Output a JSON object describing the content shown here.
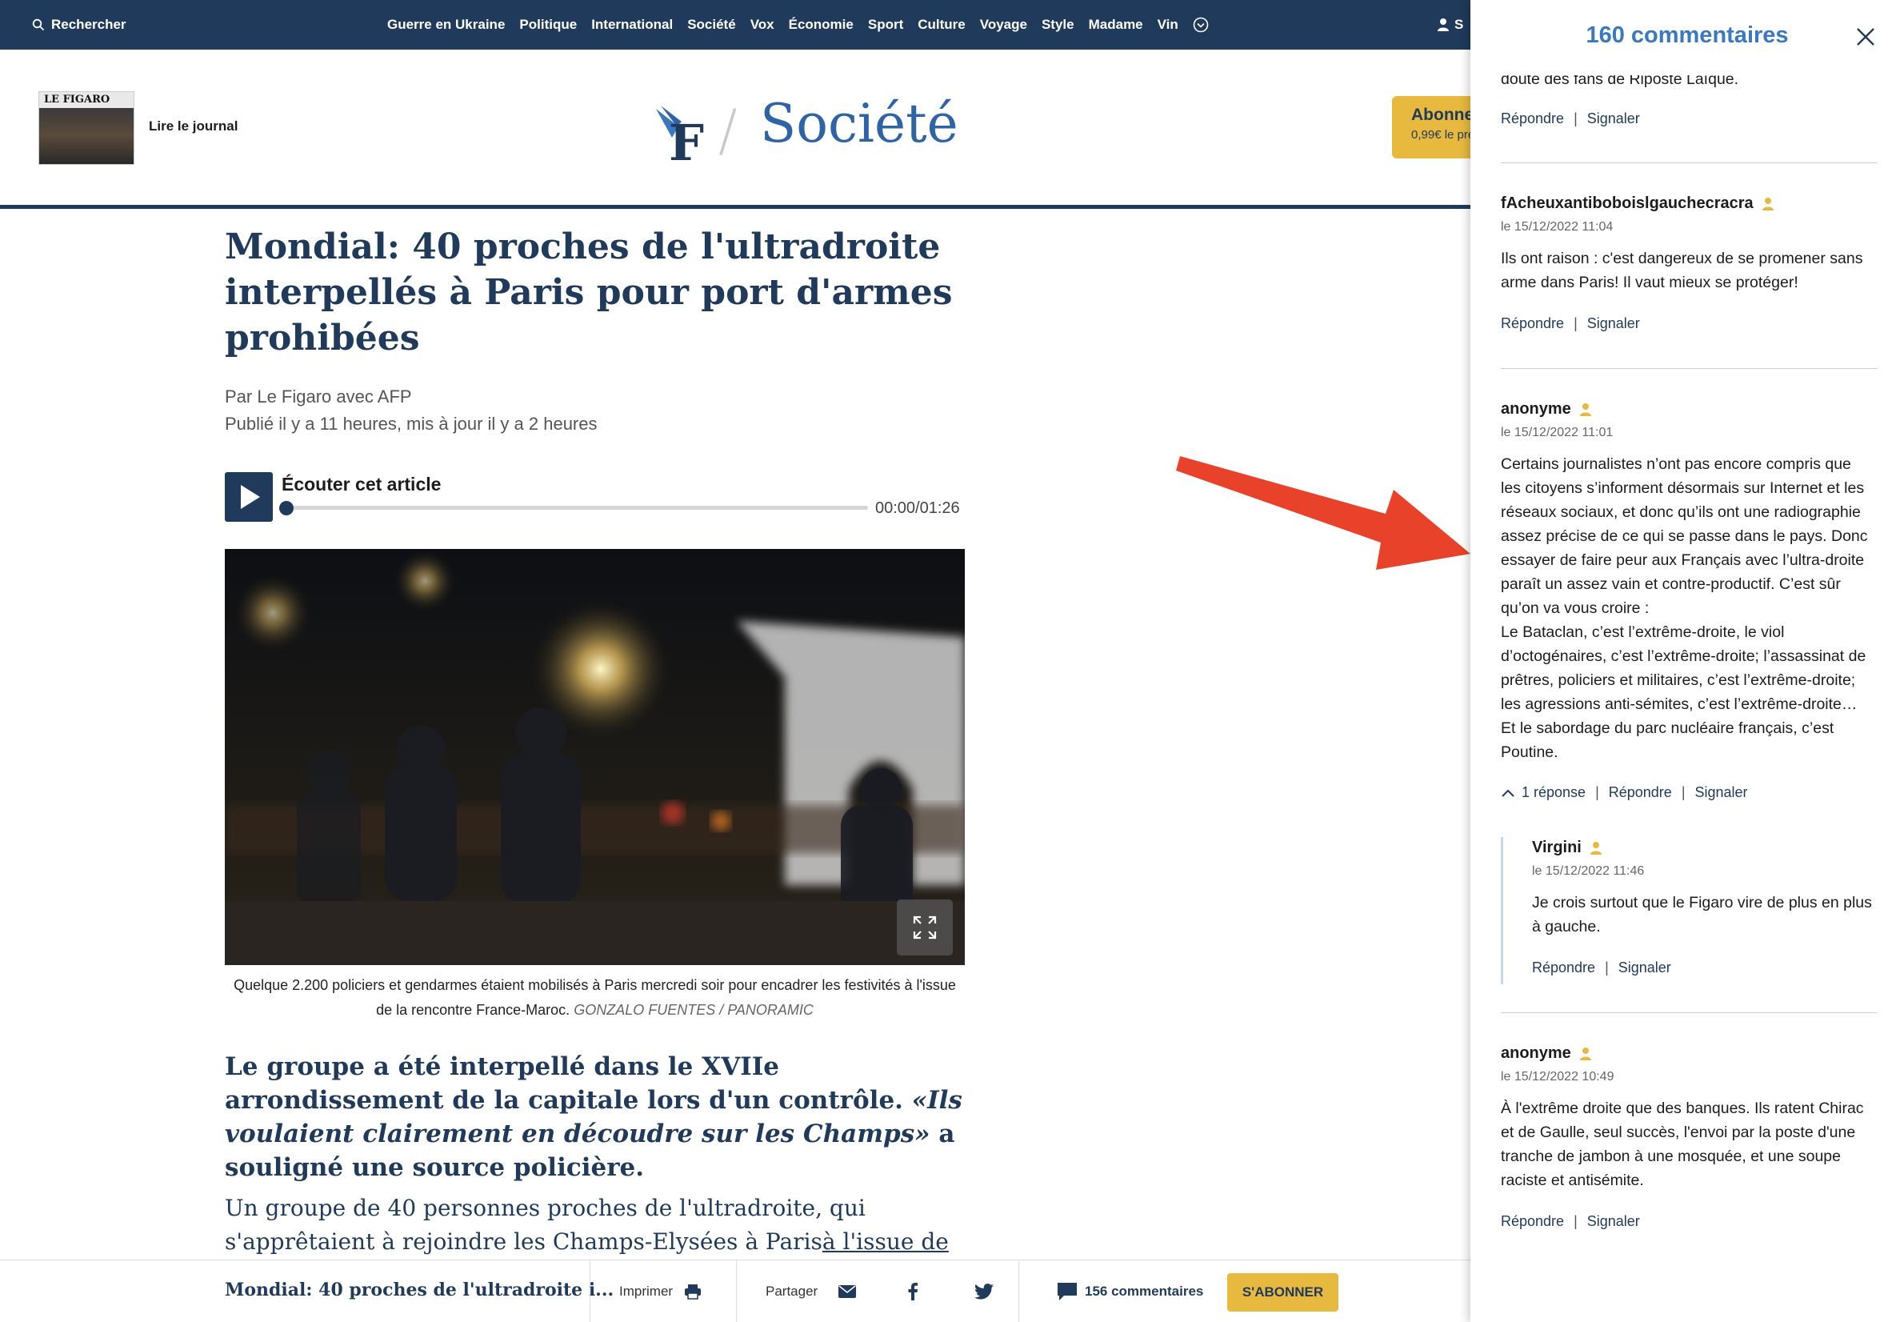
{
  "nav": {
    "search_label": "Rechercher",
    "items": [
      "Guerre en Ukraine",
      "Politique",
      "International",
      "Société",
      "Vox",
      "Économie",
      "Sport",
      "Culture",
      "Voyage",
      "Style",
      "Madame",
      "Vin"
    ],
    "user_label": "S"
  },
  "masthead": {
    "journal_label": "Lire le journal",
    "journal_mast": "LE FIGARO",
    "section": "Société",
    "subscribe_l1": "Abonne",
    "subscribe_l2": "0,99€ le pre"
  },
  "article": {
    "title": "Mondial: 40 proches de l'ultradroite interpellés à Paris pour port d'armes prohibées",
    "author": "Par Le Figaro avec AFP",
    "published": "Publié il y a 11 heures, mis à jour il y a 2 heures",
    "audio_label": "Écouter cet article",
    "audio_time": "00:00/01:26",
    "audio_progress": 0,
    "caption_main": "Quelque 2.200 policiers et gendarmes étaient mobilisés à Paris mercredi soir pour encadrer les festivités à l'issue de la rencontre France-Maroc.",
    "caption_credit": "GONZALO FUENTES / PANORAMIC",
    "chapo_a": "Le groupe a été interpellé dans le XVIIe arrondissement de la capitale lors d'un contrôle. ",
    "chapo_quote": "«Ils voulaient clairement en découdre sur les Champs»",
    "chapo_b": " a souligné une source policière.",
    "body_a": "Un groupe de 40 personnes proches de l'ultradroite, qui s'apprêtaient à rejoindre les Champs-Elysées à Paris",
    "body_link": "à l'issue de la demi-finale du"
  },
  "bottombar": {
    "title": "Mondial: 40 proches de l'ultradroite i...",
    "print": "Imprimer",
    "share": "Partager",
    "comments": "156 commentaires",
    "subscribe": "S'ABONNER"
  },
  "comments_panel": {
    "title": "160 commentaires",
    "reply": "Répondre",
    "report": "Signaler",
    "partial_text": "doute des fans de Riposte Laïque.",
    "items": [
      {
        "author": "fAcheuxantiboboislgauchecracra",
        "date": "le 15/12/2022 11:04",
        "text": "Ils ont raison : c'est dangereux de se promener sans arme dans Paris! Il vaut mieux se protéger!"
      },
      {
        "author": "anonyme",
        "date": "le 15/12/2022 11:01",
        "text_lines": [
          "Certains journalistes n’ont pas encore compris que",
          "les citoyens s’informent désormais sur Internet et les",
          "réseaux sociaux, et donc qu’ils ont une radiographie",
          "assez précise de ce qui se passe dans le pays. Donc",
          "essayer de faire peur aux Français avec l’ultra-droite",
          "paraît un assez vain et contre-productif. C’est sûr",
          "qu’on va vous croire :",
          "Le Bataclan, c’est l’extrême-droite, le viol",
          "d’octogénaires, c’est l’extrême-droite; l’assassinat de",
          "prêtres, policiers et militaires, c’est l’extrême-droite;",
          "les agressions anti-sémites, c’est l’extrême-droite…",
          "Et le sabordage du parc nucléaire français, c’est",
          "Poutine."
        ],
        "replies_label": "1 réponse"
      },
      {
        "author": "Virgini",
        "date": "le 15/12/2022 11:46",
        "text": "Je crois surtout que le Figaro vire de plus en plus à gauche."
      },
      {
        "author": "anonyme",
        "date": "le 15/12/2022 10:49",
        "text": "À l'extrême droite que des banques. Ils ratent Chirac et de Gaulle, seul succès, l'envoi par la poste d'une tranche de jambon à une mosquée, et une soupe raciste et antisémite."
      }
    ]
  },
  "colors": {
    "navy": "#1f3a5a",
    "blue": "#3a78bf",
    "gold": "#e7b93f",
    "arrow": "#e8432a"
  }
}
